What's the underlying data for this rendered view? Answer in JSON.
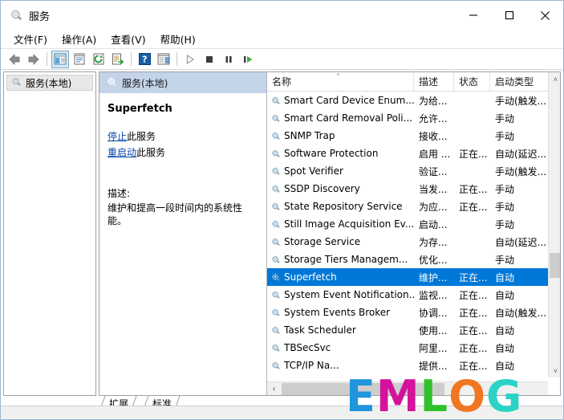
{
  "window": {
    "title": "服务",
    "icon": "services-gear-icon",
    "minimize_label": "—",
    "maximize_label": "□",
    "close_label": "✕"
  },
  "menubar": {
    "items": [
      {
        "label": "文件(F)",
        "name": "menu-file"
      },
      {
        "label": "操作(A)",
        "name": "menu-action"
      },
      {
        "label": "查看(V)",
        "name": "menu-view"
      },
      {
        "label": "帮助(H)",
        "name": "menu-help"
      }
    ]
  },
  "toolbar": {
    "buttons": [
      {
        "name": "back-arrow-icon",
        "glyph": "back"
      },
      {
        "name": "forward-arrow-icon",
        "glyph": "forward"
      },
      {
        "name": "show-hide-tree-icon",
        "glyph": "treepane",
        "selected": true
      },
      {
        "name": "properties-icon",
        "glyph": "props"
      },
      {
        "name": "refresh-icon",
        "glyph": "refresh"
      },
      {
        "name": "export-list-icon",
        "glyph": "export"
      },
      {
        "name": "help-icon",
        "glyph": "help"
      },
      {
        "name": "show-action-pane-icon",
        "glyph": "actionpane"
      },
      {
        "name": "start-service-icon",
        "glyph": "play"
      },
      {
        "name": "stop-service-icon",
        "glyph": "stop"
      },
      {
        "name": "pause-service-icon",
        "glyph": "pause"
      },
      {
        "name": "restart-service-icon",
        "glyph": "restart"
      }
    ]
  },
  "tree": {
    "root_label": "服务(本地)",
    "root_icon": "services-gear-icon"
  },
  "detail": {
    "header_label": "服务(本地)",
    "header_icon": "services-gear-icon",
    "service_name": "Superfetch",
    "stop_link": "停止",
    "stop_suffix": "此服务",
    "restart_link": "重启动",
    "restart_suffix": "此服务",
    "description_label": "描述:",
    "description_text": "维护和提高一段时间内的系统性能。"
  },
  "list": {
    "columns": [
      {
        "key": "name",
        "label": "名称",
        "sorted": true,
        "sort_dir": "asc"
      },
      {
        "key": "desc",
        "label": "描述"
      },
      {
        "key": "state",
        "label": "状态"
      },
      {
        "key": "start",
        "label": "启动类型"
      }
    ],
    "rows": [
      {
        "name": "Smart Card Device Enum...",
        "desc": "为给...",
        "state": "",
        "start": "手动(触发..."
      },
      {
        "name": "Smart Card Removal Poli...",
        "desc": "允许...",
        "state": "",
        "start": "手动"
      },
      {
        "name": "SNMP Trap",
        "desc": "接收...",
        "state": "",
        "start": "手动"
      },
      {
        "name": "Software Protection",
        "desc": "启用 ...",
        "state": "正在...",
        "start": "自动(延迟..."
      },
      {
        "name": "Spot Verifier",
        "desc": "验证...",
        "state": "",
        "start": "手动(触发..."
      },
      {
        "name": "SSDP Discovery",
        "desc": "当发...",
        "state": "正在...",
        "start": "手动"
      },
      {
        "name": "State Repository Service",
        "desc": "为应...",
        "state": "正在...",
        "start": "手动"
      },
      {
        "name": "Still Image Acquisition Ev...",
        "desc": "启动...",
        "state": "",
        "start": "手动"
      },
      {
        "name": "Storage Service",
        "desc": "为存...",
        "state": "",
        "start": "自动(延迟..."
      },
      {
        "name": "Storage Tiers Managem...",
        "desc": "优化...",
        "state": "",
        "start": "手动"
      },
      {
        "name": "Superfetch",
        "desc": "维护...",
        "state": "正在...",
        "start": "自动",
        "selected": true
      },
      {
        "name": "System Event Notification...",
        "desc": "监视...",
        "state": "正在...",
        "start": "自动"
      },
      {
        "name": "System Events Broker",
        "desc": "协调...",
        "state": "正在...",
        "start": "自动(触发..."
      },
      {
        "name": "Task Scheduler",
        "desc": "使用...",
        "state": "正在...",
        "start": "自动"
      },
      {
        "name": "TBSecSvc",
        "desc": "阿里...",
        "state": "正在...",
        "start": "自动"
      },
      {
        "name": "TCP/IP Na...",
        "desc": "提供...",
        "state": "正在...",
        "start": "自动"
      }
    ],
    "scroll_up_glyph": "˄",
    "scroll_down_glyph": "˅",
    "scroll_left_glyph": "‹",
    "row_icon": "service-gear-icon"
  },
  "tabs": [
    {
      "label": "扩展",
      "name": "tab-extended",
      "active": false
    },
    {
      "label": "标准",
      "name": "tab-standard",
      "active": true
    }
  ],
  "watermark": {
    "letters": [
      {
        "char": "E",
        "color": "#1e95dc"
      },
      {
        "char": "M",
        "color": "#d4129b"
      },
      {
        "char": "L",
        "color": "#30c12a"
      },
      {
        "char": "O",
        "color": "#f07722"
      },
      {
        "char": "G",
        "color": "#2ad3c6"
      }
    ]
  },
  "colors": {
    "selection": "#0078d7",
    "detail_header": "#c3d4e8",
    "link": "#0645ad",
    "window_border": "#9bb7d4"
  }
}
